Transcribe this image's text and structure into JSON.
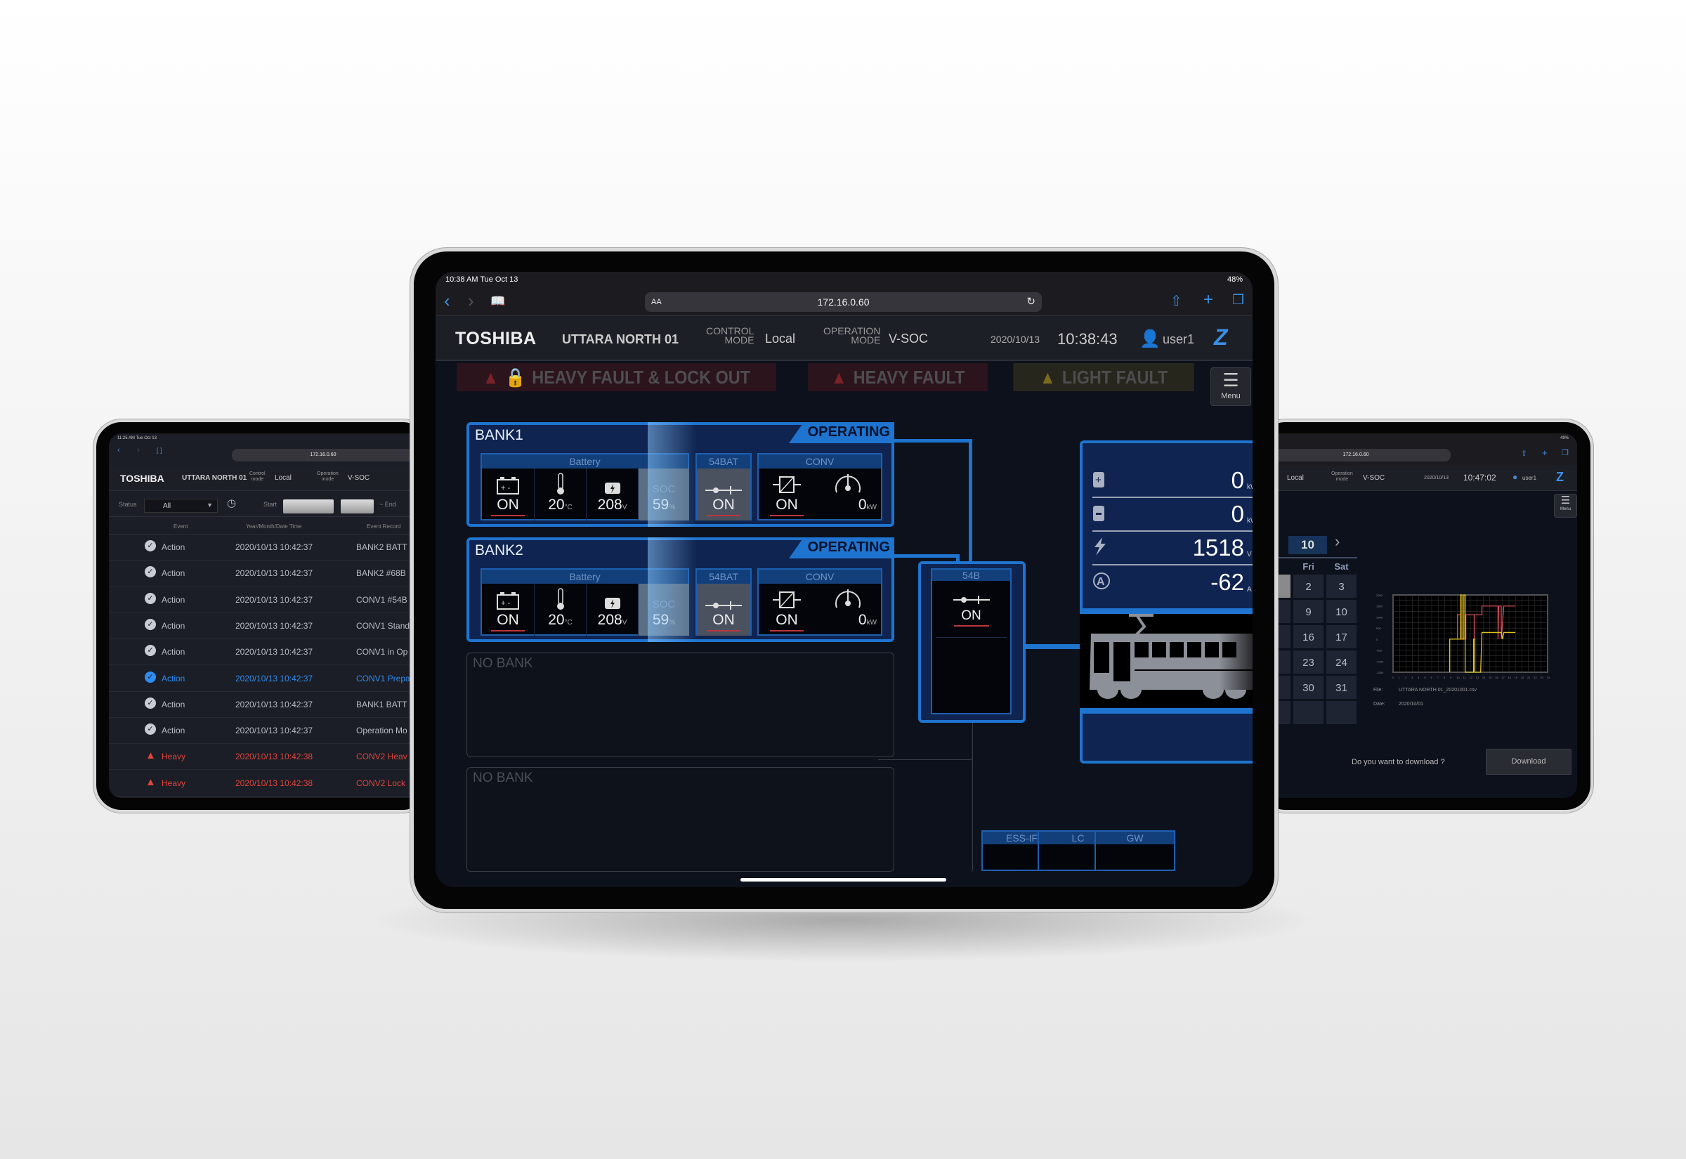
{
  "main": {
    "status_bar": {
      "time": "10:38 AM  Tue Oct 13",
      "battery": "48%"
    },
    "browser": {
      "url": "172.16.0.60",
      "text_size": "AA"
    },
    "header": {
      "brand": "TOSHIBA",
      "site": "UTTARA NORTH 01",
      "control_mode_label_1": "CONTROL",
      "control_mode_label_2": "MODE",
      "control_mode": "Local",
      "operation_mode_label_1": "OPERATION",
      "operation_mode_label_2": "MODE",
      "operation_mode": "V-SOC",
      "date": "2020/10/13",
      "time": "10:38:43",
      "user": "user1"
    },
    "faults": [
      {
        "label": "HEAVY FAULT & LOCK OUT",
        "color": "#6b1c22"
      },
      {
        "label": "HEAVY FAULT",
        "color": "#6b1c22"
      },
      {
        "label": "LIGHT FAULT",
        "color": "#5b5220"
      }
    ],
    "menu_label": "Menu",
    "banks": [
      {
        "name": "BANK1",
        "status": "OPERATING",
        "battery_label": "Battery",
        "battery_state": "ON",
        "temp": "20",
        "temp_unit": "°C",
        "voltage": "208",
        "voltage_unit": "V",
        "soc_label": "SOC",
        "soc": "59",
        "soc_unit": "%",
        "breaker_label": "54BAT",
        "breaker_state": "ON",
        "conv_label": "CONV",
        "conv_state": "ON",
        "power": "0",
        "power_unit": "kW"
      },
      {
        "name": "BANK2",
        "status": "OPERATING",
        "battery_label": "Battery",
        "battery_state": "ON",
        "temp": "20",
        "temp_unit": "°C",
        "voltage": "208",
        "voltage_unit": "V",
        "soc_label": "SOC",
        "soc": "59",
        "soc_unit": "%",
        "breaker_label": "54BAT",
        "breaker_state": "ON",
        "conv_label": "CONV",
        "conv_state": "ON",
        "power": "0",
        "power_unit": "kW"
      }
    ],
    "empty_banks": [
      "NO BANK",
      "NO BANK"
    ],
    "main_breaker": {
      "label": "54B",
      "state": "ON"
    },
    "measurements": [
      {
        "icon": "battery-charge-icon",
        "value": "0",
        "unit": "kWh"
      },
      {
        "icon": "battery-discharge-icon",
        "value": "0",
        "unit": "kWh"
      },
      {
        "icon": "lightning-icon",
        "value": "1518",
        "unit": "V"
      },
      {
        "icon": "ampere-icon",
        "value": "-62",
        "unit": "A"
      }
    ],
    "comm_tags": [
      "ESS-IF",
      "LC",
      "GW"
    ],
    "accent": "#1f74d0"
  },
  "left": {
    "status_bar": "11:25 AM  Tue Oct 13",
    "url": "172.16.0.60",
    "brand": "TOSHIBA",
    "site": "UTTARA NORTH 01",
    "control_label_1": "Control",
    "control_label_2": "mode",
    "control_mode": "Local",
    "operation_label_1": "Operation",
    "operation_label_2": "mode",
    "operation_mode": "V-SOC",
    "filter": {
      "status_label": "Status",
      "status_value": "All",
      "start_label": "Start",
      "end_label": "~  End"
    },
    "columns": [
      "Event",
      "Year/Month/Date Time",
      "Event Record"
    ],
    "rows": [
      {
        "event": "Action",
        "datetime": "2020/10/13 10:42:37",
        "record": "BANK2 BATT",
        "level": "normal"
      },
      {
        "event": "Action",
        "datetime": "2020/10/13 10:42:37",
        "record": "BANK2 #68B",
        "level": "normal"
      },
      {
        "event": "Action",
        "datetime": "2020/10/13 10:42:37",
        "record": "CONV1 #54B",
        "level": "normal"
      },
      {
        "event": "Action",
        "datetime": "2020/10/13 10:42:37",
        "record": "CONV1 Stand",
        "level": "normal"
      },
      {
        "event": "Action",
        "datetime": "2020/10/13 10:42:37",
        "record": "CONV1 in Op",
        "level": "normal"
      },
      {
        "event": "Action",
        "datetime": "2020/10/13 10:42:37",
        "record": "CONV1 Prepa",
        "level": "selected"
      },
      {
        "event": "Action",
        "datetime": "2020/10/13 10:42:37",
        "record": "BANK1 BATT",
        "level": "normal"
      },
      {
        "event": "Action",
        "datetime": "2020/10/13 10:42:37",
        "record": "Operation Mo",
        "level": "normal"
      },
      {
        "event": "Heavy",
        "datetime": "2020/10/13 10:42:38",
        "record": "CONV2 Heav",
        "level": "heavy"
      },
      {
        "event": "Heavy",
        "datetime": "2020/10/13 10:42:38",
        "record": "CONV2 Lock",
        "level": "heavy"
      }
    ]
  },
  "right": {
    "status_bar": "49%",
    "url": "172.16.0.60",
    "control_mode": "Local",
    "operation_label_1": "Operation",
    "operation_label_2": "mode",
    "operation_mode": "V-SOC",
    "date": "2020/10/13",
    "time": "10:47:02",
    "user": "user1",
    "menu_label": "Menu",
    "calendar": {
      "month": "10",
      "weekday_headers": [
        "u",
        "Fri",
        "Sat"
      ],
      "rows": [
        [
          "",
          "2",
          "3"
        ],
        [
          "8",
          "9",
          "10"
        ],
        [
          "5",
          "16",
          "17"
        ],
        [
          "2",
          "23",
          "24"
        ],
        [
          "9",
          "30",
          "31"
        ],
        [
          "",
          "",
          ""
        ]
      ]
    },
    "file_label": "File:",
    "file": "UTTARA NORTH 01_20201001.csv",
    "date_label": "Date:",
    "file_date": "2020/10/01",
    "download_prompt": "Do you want to download ?",
    "download_button": "Download"
  },
  "chart_data": {
    "type": "line",
    "x_ticks": [
      "0",
      "1",
      "2",
      "3",
      "4",
      "5",
      "6",
      "7",
      "8",
      "9",
      "10",
      "11",
      "12",
      "13",
      "14",
      "15",
      "16",
      "17",
      "18",
      "19",
      "20",
      "21",
      "22",
      "23",
      "24"
    ],
    "y_ticks": [
      "2000",
      "1500",
      "1000",
      "500",
      "0",
      "-500",
      "-1000",
      "-1500"
    ],
    "xlim": [
      0,
      24
    ],
    "ylim": [
      -1500,
      2000
    ],
    "grid": true,
    "series": [
      {
        "color": "#d9505a",
        "points": [
          [
            8.8,
            0
          ],
          [
            10,
            0
          ],
          [
            10,
            1100
          ],
          [
            10.5,
            1100
          ],
          [
            10.5,
            0
          ],
          [
            11.3,
            0
          ],
          [
            11.3,
            1100
          ],
          [
            12.6,
            1100
          ],
          [
            12.6,
            0
          ],
          [
            12.6,
            1100
          ],
          [
            13.8,
            1100
          ],
          [
            13.8,
            1500
          ],
          [
            16.3,
            1500
          ],
          [
            16.3,
            0
          ],
          [
            16.4,
            1500
          ],
          [
            16.8,
            1500
          ],
          [
            16.8,
            0
          ],
          [
            17.2,
            1500
          ],
          [
            19,
            1500
          ]
        ]
      },
      {
        "color": "#e3c21a",
        "points": [
          [
            8.8,
            -1500
          ],
          [
            8.8,
            0
          ],
          [
            10.5,
            0
          ],
          [
            10.5,
            2000
          ],
          [
            10.7,
            2000
          ],
          [
            10.7,
            0
          ],
          [
            11,
            0
          ],
          [
            11,
            2000
          ],
          [
            11.2,
            2000
          ],
          [
            11.2,
            -1500
          ],
          [
            12.5,
            -1500
          ],
          [
            12.5,
            0
          ],
          [
            12.7,
            0
          ],
          [
            12.7,
            -1500
          ],
          [
            13.6,
            -1500
          ],
          [
            13.8,
            300
          ],
          [
            16.8,
            300
          ],
          [
            17,
            0
          ],
          [
            17.2,
            300
          ],
          [
            19,
            300
          ]
        ]
      }
    ]
  }
}
